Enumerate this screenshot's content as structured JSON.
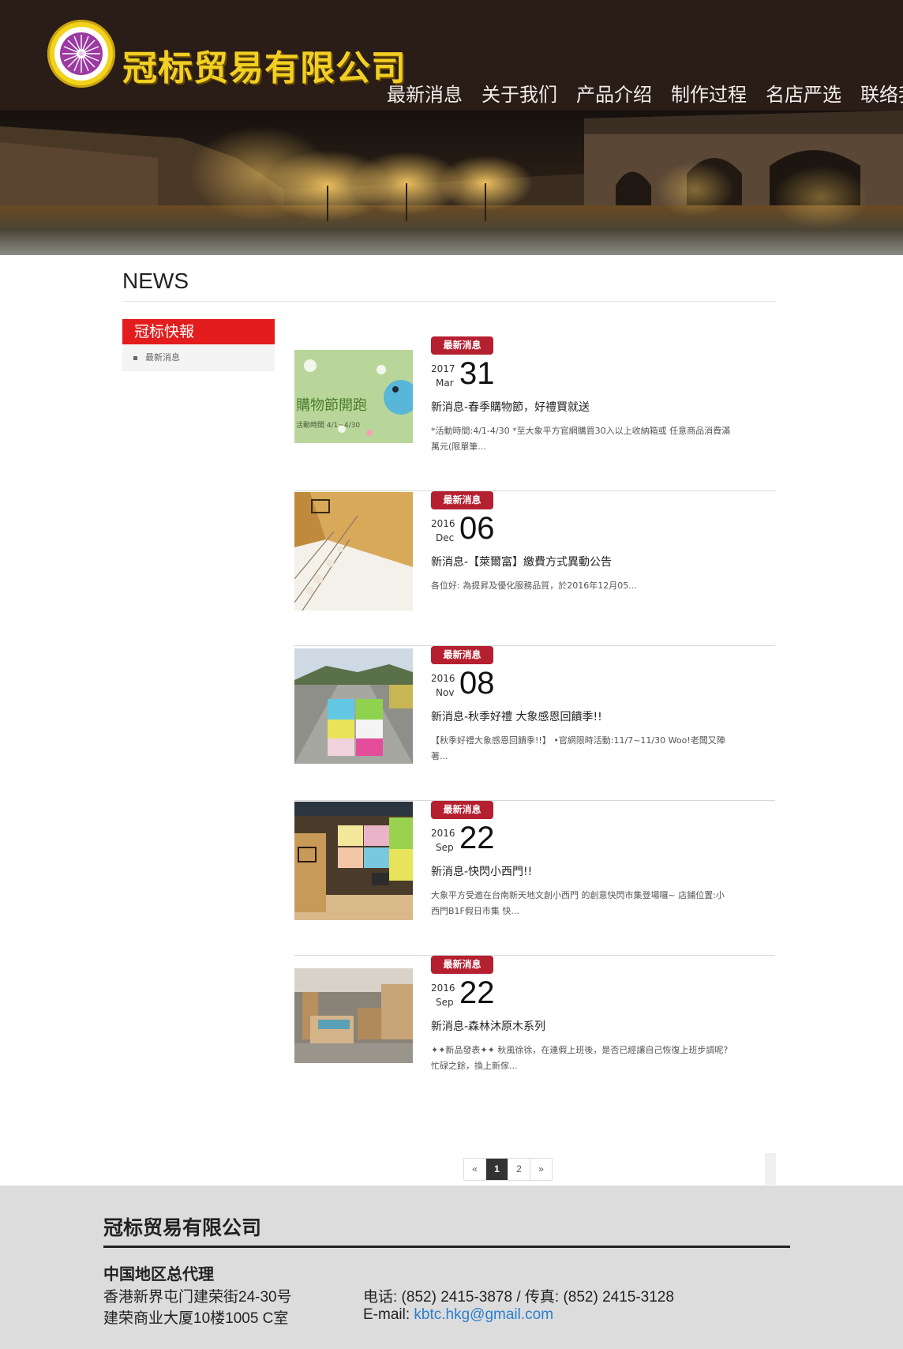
{
  "brand": {
    "name": "冠标贸易有限公司"
  },
  "nav": [
    "最新消息",
    "关于我们",
    "产品介绍",
    "制作过程",
    "名店严选",
    "联络我们"
  ],
  "page_title": "NEWS",
  "sidebar": {
    "heading": "冠标快報",
    "items": [
      "最新消息"
    ]
  },
  "news": [
    {
      "badge": "最新消息",
      "year": "2017",
      "month": "Mar",
      "day": "31",
      "headline": "新消息-春季購物節，好禮買就送",
      "summary": "*活動時間:4/1-4/30 *至大象平方官網購買30入以上收納箱或 任意商品消費滿萬元(限單筆...",
      "thumb_text": "購物節開跑",
      "thumb_sub": "活動時間 4/1~4/30"
    },
    {
      "badge": "最新消息",
      "year": "2016",
      "month": "Dec",
      "day": "06",
      "headline": "新消息-【萊爾富】繳費方式異動公告",
      "summary": "各位好: 為提昇及優化服務品質，於2016年12月05..."
    },
    {
      "badge": "最新消息",
      "year": "2016",
      "month": "Nov",
      "day": "08",
      "headline": "新消息-秋季好禮 大象感恩回饋季!!",
      "summary": "【秋季好禮大象感恩回饋季!!】 •官網限時活動:11/7~11/30 Woo!老闆又陣著..."
    },
    {
      "badge": "最新消息",
      "year": "2016",
      "month": "Sep",
      "day": "22",
      "headline": "新消息-快閃小西門!!",
      "summary": "大象平方受邀在台南新天地文創小西門 的創意快閃市集登場囉~ 店鋪位置:小西門B1F假日市集 快..."
    },
    {
      "badge": "最新消息",
      "year": "2016",
      "month": "Sep",
      "day": "22",
      "headline": "新消息-森林沐原木系列",
      "summary": "✦✦新品發表✦✦ 秋風徐徐，在連假上班後，是否已經讓自己恢復上班步調呢? 忙碌之餘，換上新傢..."
    }
  ],
  "pagination": {
    "prev": "«",
    "pages": [
      "1",
      "2"
    ],
    "current": "1",
    "next": "»"
  },
  "footer": {
    "company": "冠标贸易有限公司",
    "region": "中国地区总代理",
    "address_line1": "香港新界屯门建荣街24-30号",
    "address_line2": "建荣商业大厦10楼1005 C室",
    "phone": "电话: (852) 2415-3878 / 传真: (852) 2415-3128",
    "email_label": "E-mail: ",
    "email": "kbtc.hkg@gmail.com"
  },
  "colors": {
    "header_bg": "#2a1c17",
    "brand_yellow": "#f2cf23",
    "sidebar_red": "#e31d1d",
    "badge_red": "#b52030",
    "footer_bg": "#dcdcdc",
    "link_blue": "#2a7fd0"
  }
}
